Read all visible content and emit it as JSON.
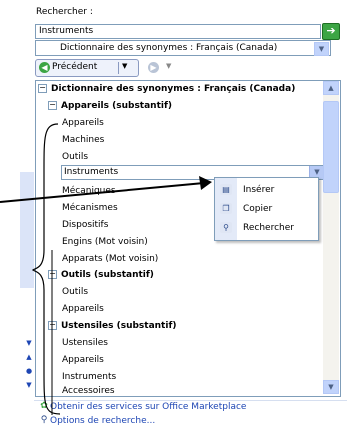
{
  "search": {
    "label": "Rechercher :",
    "value": "Instruments",
    "go_icon": "arrow-right",
    "dictionary": "Dictionnaire des synonymes : Français (Canada)"
  },
  "nav": {
    "back_label": "Précédent",
    "back_arrow": "▼",
    "forward_arrow": "▼"
  },
  "results": {
    "title": "Dictionnaire des synonymes : Français (Canada)",
    "groups": [
      {
        "heading": "Appareils (substantif)",
        "items": [
          "Appareils",
          "Machines",
          "Outils",
          "Instruments",
          "Mécaniques",
          "Mécanismes",
          "Dispositifs",
          "Engins (Mot voisin)",
          "Apparats (Mot voisin)"
        ]
      },
      {
        "heading": "Outils (substantif)",
        "items": [
          "Outils",
          "Appareils"
        ]
      },
      {
        "heading": "Ustensiles (substantif)",
        "items": [
          "Ustensiles",
          "Appareils",
          "Instruments",
          "Accessoires"
        ]
      }
    ]
  },
  "context_menu": {
    "items": [
      {
        "label": "Insérer",
        "icon": "insert-icon"
      },
      {
        "label": "Copier",
        "icon": "copy-icon"
      },
      {
        "label": "Rechercher",
        "icon": "research-icon"
      }
    ]
  },
  "bottom_links": {
    "marketplace": "Obtenir des services sur Office Marketplace",
    "options": "Options de recherche..."
  },
  "colors": {
    "accent_green": "#3ca544",
    "link_blue": "#1e46b4",
    "border": "#7f9db9",
    "scroll_blue": "#c1d3fb"
  }
}
